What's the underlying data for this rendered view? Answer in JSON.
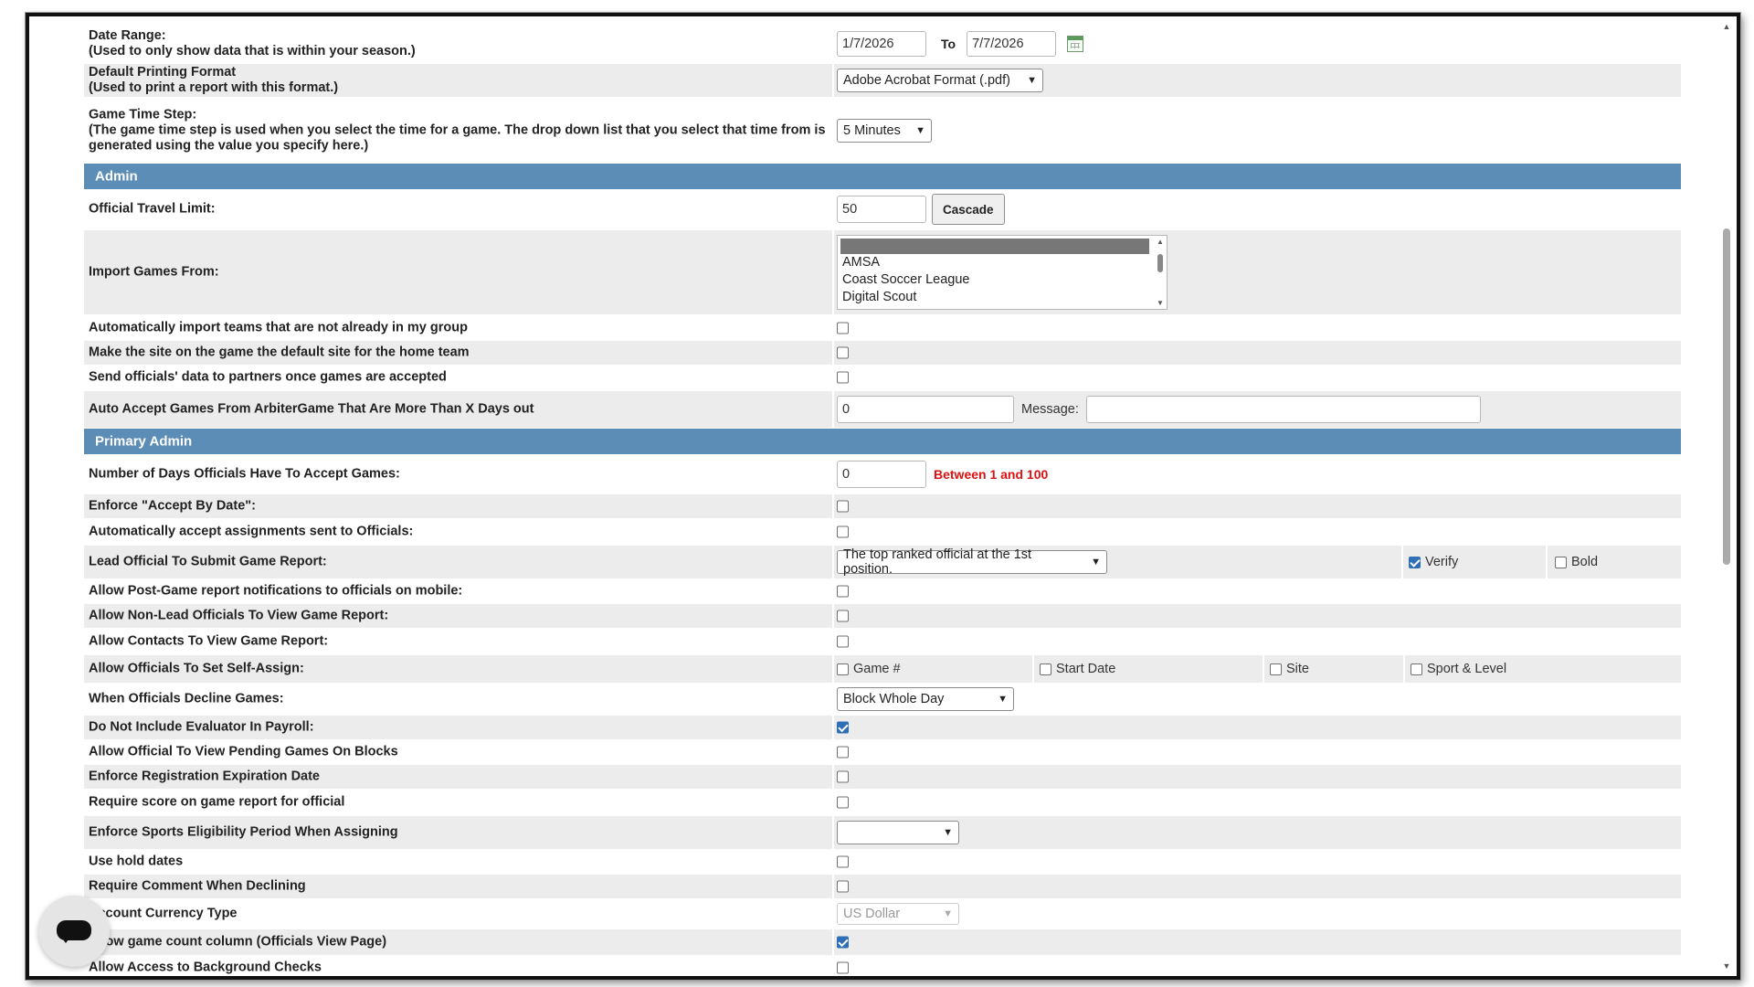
{
  "date_range": {
    "label": "Date Range:",
    "note": "(Used to only show data that is within your season.)",
    "start": "1/7/2026",
    "to_label": "To",
    "end": "7/7/2026"
  },
  "default_printing": {
    "label": "Default Printing Format",
    "note": "(Used to print a report with this format.)",
    "value": "Adobe Acrobat Format (.pdf)"
  },
  "game_time_step": {
    "label": "Game Time Step:",
    "note": "(The game time step is used when you select the time for a game. The drop down list that you select that time from is generated using the value you specify here.)",
    "value": "5 Minutes"
  },
  "admin_section": "Admin",
  "official_travel_limit": {
    "label": "Official Travel Limit:",
    "value": "50",
    "button": "Cascade"
  },
  "import_games": {
    "label": "Import Games From:",
    "options": [
      "AMSA",
      "Coast Soccer League",
      "Digital Scout"
    ]
  },
  "auto_import_teams": {
    "label": "Automatically import teams that are not already in my group",
    "checked": false
  },
  "default_site": {
    "label": "Make the site on the game the default site for the home team",
    "checked": false
  },
  "send_officials_data": {
    "label": "Send officials' data to partners once games are accepted",
    "checked": false
  },
  "auto_accept": {
    "label": "Auto Accept Games From ArbiterGame That Are More Than X Days out",
    "value": "0",
    "message_label": "Message:",
    "message_value": ""
  },
  "primary_admin_section": "Primary Admin",
  "days_to_accept": {
    "label": "Number of Days Officials Have To Accept Games:",
    "value": "0",
    "hint": "Between 1 and 100"
  },
  "enforce_accept_by": {
    "label": "Enforce \"Accept By Date\":",
    "checked": false
  },
  "auto_accept_assignments": {
    "label": "Automatically accept assignments sent to Officials:",
    "checked": false
  },
  "lead_official": {
    "label": "Lead Official To Submit Game Report:",
    "value": "The top ranked official at the 1st position.",
    "verify_label": "Verify",
    "verify_checked": true,
    "bold_label": "Bold",
    "bold_checked": false
  },
  "post_game_notifications": {
    "label": "Allow Post-Game report notifications to officials on mobile:",
    "checked": false
  },
  "non_lead_view": {
    "label": "Allow Non-Lead Officials To View Game Report:",
    "checked": false
  },
  "contacts_view": {
    "label": "Allow Contacts To View Game Report:",
    "checked": false
  },
  "self_assign": {
    "label": "Allow Officials To Set Self-Assign:",
    "options": [
      {
        "label": "Game #",
        "checked": false
      },
      {
        "label": "Start Date",
        "checked": false
      },
      {
        "label": "Site",
        "checked": false
      },
      {
        "label": "Sport & Level",
        "checked": false
      }
    ]
  },
  "decline_games": {
    "label": "When Officials Decline Games:",
    "value": "Block Whole Day"
  },
  "exclude_evaluator": {
    "label": "Do Not Include Evaluator In Payroll:",
    "checked": true
  },
  "view_pending_blocks": {
    "label": "Allow Official To View Pending Games On Blocks",
    "checked": false
  },
  "enforce_registration": {
    "label": "Enforce Registration Expiration Date",
    "checked": false
  },
  "require_score": {
    "label": "Require score on game report for official",
    "checked": false
  },
  "sports_eligibility": {
    "label": "Enforce Sports Eligibility Period When Assigning",
    "value": ""
  },
  "use_hold_dates": {
    "label": "Use hold dates",
    "checked": false
  },
  "require_comment": {
    "label": "Require Comment When Declining",
    "checked": false
  },
  "currency": {
    "label": "Account Currency Type",
    "value": "US Dollar"
  },
  "game_count_column": {
    "label": "Show game count column (Officials View Page)",
    "checked": true
  },
  "background_checks": {
    "label": "Allow Access to Background Checks",
    "checked": false
  },
  "icons": {
    "calendar": "calendar-icon",
    "chat": "chat-icon"
  }
}
